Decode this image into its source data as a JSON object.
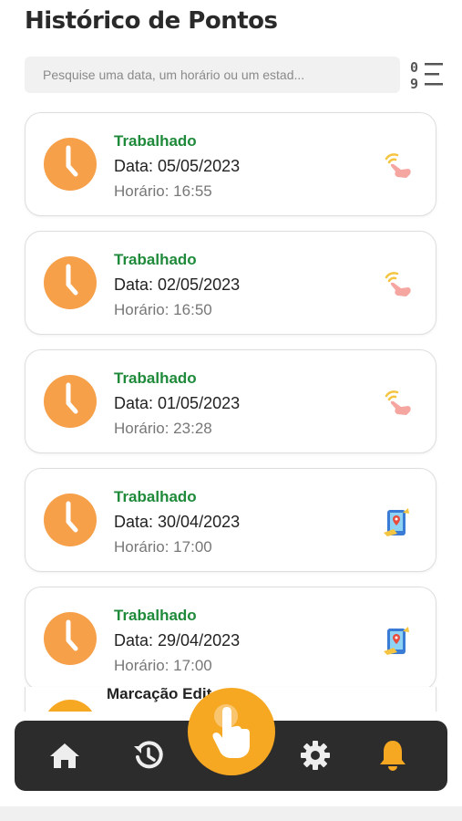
{
  "header": {
    "title": "Histórico de Pontos"
  },
  "search": {
    "placeholder": "Pesquise uma data, um horário ou um estad..."
  },
  "records": [
    {
      "status": "Trabalhado",
      "date": "Data: 05/05/2023",
      "time": "Horário: 16:55",
      "method_icon": "touch-icon"
    },
    {
      "status": "Trabalhado",
      "date": "Data: 02/05/2023",
      "time": "Horário: 16:50",
      "method_icon": "touch-icon"
    },
    {
      "status": "Trabalhado",
      "date": "Data: 01/05/2023",
      "time": "Horário: 23:28",
      "method_icon": "touch-icon"
    },
    {
      "status": "Trabalhado",
      "date": "Data: 30/04/2023",
      "time": "Horário: 17:00",
      "method_icon": "mobile-location-icon"
    },
    {
      "status": "Trabalhado",
      "date": "Data: 29/04/2023",
      "time": "Horário: 17:00",
      "method_icon": "mobile-location-icon"
    },
    {
      "status": "Marcação Edit"
    }
  ],
  "nav": {
    "items": [
      "home-icon",
      "history-icon",
      "punch-clock-icon",
      "gear-icon",
      "bell-icon"
    ]
  },
  "colors": {
    "accent": "#f6a823",
    "status_green": "#1f8a3a",
    "navbar": "#2c2c2c",
    "notification": "#f6a823"
  }
}
